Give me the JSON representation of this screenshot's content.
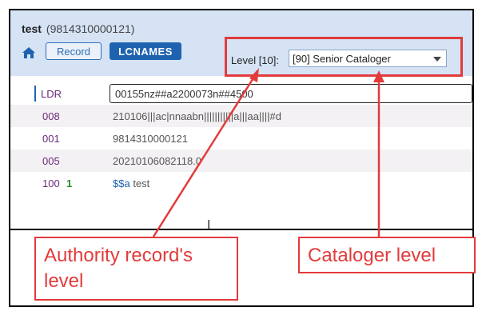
{
  "record": {
    "title": "test",
    "id": "(9814310000121)"
  },
  "toolbar": {
    "record_label": "Record",
    "lcnames_label": "LCNAMES",
    "level_label": "Level [10]:",
    "level_select_value": "[90] Senior Cataloger"
  },
  "rows": [
    {
      "tag": "LDR",
      "ind": "",
      "value": "00155nz##a2200073n##4500"
    },
    {
      "tag": "008",
      "ind": "",
      "value": "210106|||ac|nnaabn|||||||||||a|||aa||||#d"
    },
    {
      "tag": "001",
      "ind": "",
      "value": "9814310000121"
    },
    {
      "tag": "005",
      "ind": "",
      "value": "20210106082118.0"
    },
    {
      "tag": "100",
      "ind": "1",
      "subfield": "$$a",
      "value": "test"
    }
  ],
  "annotations": {
    "left_callout": "Authority record's level",
    "right_callout": "Cataloger level",
    "color": "#e23b3b"
  },
  "icons": {
    "home": "home-icon",
    "text_cursor": "text-cursor-icon"
  }
}
